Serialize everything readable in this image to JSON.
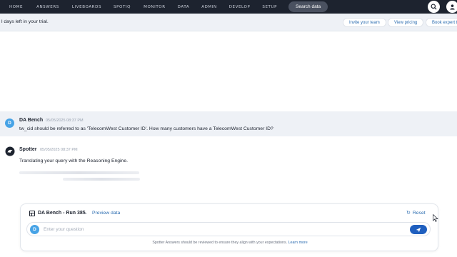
{
  "topnav": {
    "items": [
      "HOME",
      "ANSWERS",
      "LIVEBOARDS",
      "SPOTIQ",
      "MONITOR",
      "DATA",
      "ADMIN",
      "DEVELOP",
      "SETUP"
    ],
    "search_label": "Search data",
    "icons": [
      "search-icon",
      "profile-icon"
    ]
  },
  "trial": {
    "text": "l days left in your trial.",
    "invite_label": "Invite your team",
    "pricing_label": "View pricing",
    "expert_label": "Book expert t"
  },
  "messages": {
    "user": {
      "avatar_letter": "D",
      "author": "DA Bench",
      "time": "05/05/2025 08:37 PM",
      "text": "tw_cid should be referred to as 'TelecomWest Customer ID'. How many customers have a TelecomWest Customer ID?"
    },
    "spotter": {
      "author": "Spotter",
      "time": "05/05/2025 08:37 PM",
      "text": "Translating your query with the Reasoning Engine."
    }
  },
  "composer": {
    "workspace_name": "DA Bench - Run 385",
    "preview_label": "Preview data",
    "reset_label": "Reset",
    "avatar_letter": "D",
    "placeholder": "Enter your question",
    "disclaimer": "Spotter Answers should be reviewed to ensure they align with your expectations.",
    "learn_more": "Learn more"
  },
  "colors": {
    "nav_bg": "#1d232f",
    "accent": "#1f5fbf",
    "link": "#2b6cb0",
    "avatar": "#47a3e6",
    "user_row_bg": "#eef1f6"
  }
}
